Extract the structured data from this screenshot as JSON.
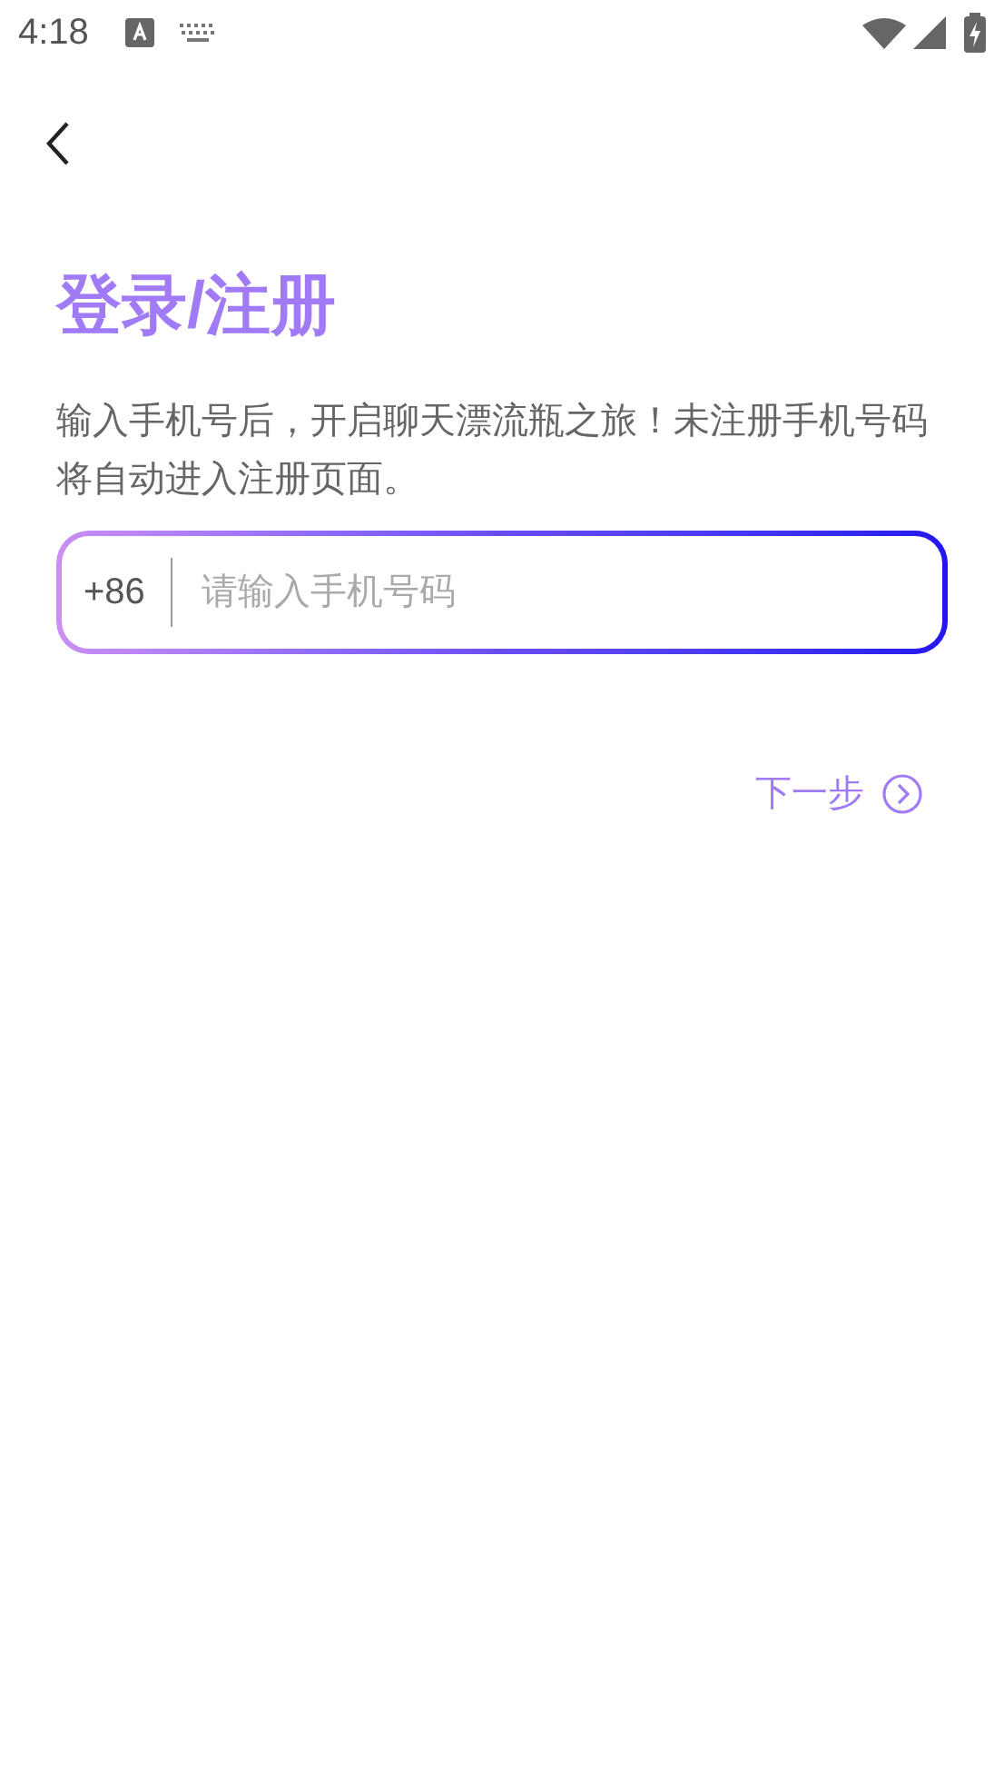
{
  "status_bar": {
    "time": "4:18"
  },
  "title": "登录/注册",
  "description": "输入手机号后，开启聊天漂流瓶之旅！未注册手机号码将自动进入注册页面。",
  "phone_field": {
    "country_code": "+86",
    "placeholder": "请输入手机号码"
  },
  "next_button": {
    "label": "下一步"
  }
}
